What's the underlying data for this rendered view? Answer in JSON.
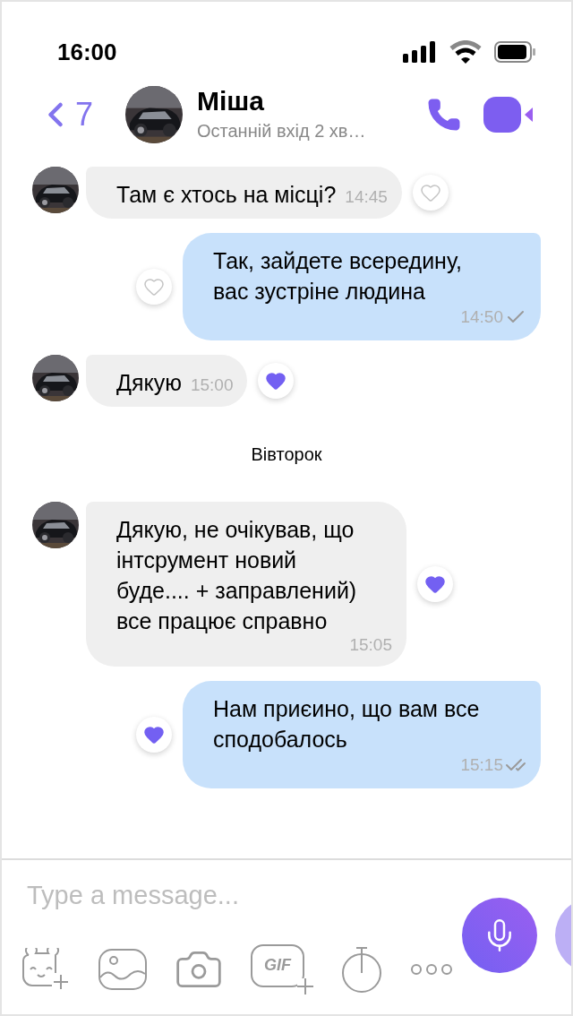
{
  "status_bar": {
    "time": "16:00"
  },
  "header": {
    "back_count": "7",
    "name": "Міша",
    "last_seen": "Останній вхід 2 хв…"
  },
  "messages": [
    {
      "kind": "incoming",
      "text": "Там є хтось на місці?",
      "time": "14:45",
      "liked": false
    },
    {
      "kind": "outgoing",
      "text": "Так, зайдете всередину, вас зустріне людина",
      "time": "14:50",
      "liked": false,
      "read": false
    },
    {
      "kind": "incoming",
      "text": "Дякую",
      "time": "15:00",
      "liked": true
    },
    {
      "kind": "date",
      "text": "Вівторок"
    },
    {
      "kind": "incoming",
      "text": "Дякую, не очікував, що інтсрумент новий буде.... + заправлений) все працює справно",
      "time": "15:05",
      "liked": true
    },
    {
      "kind": "outgoing",
      "text": "Нам приєино, що вам все сподобалось",
      "time": "15:15",
      "liked": true,
      "read": true
    }
  ],
  "composer": {
    "placeholder": "Type a message...",
    "gif_label": "GIF"
  }
}
